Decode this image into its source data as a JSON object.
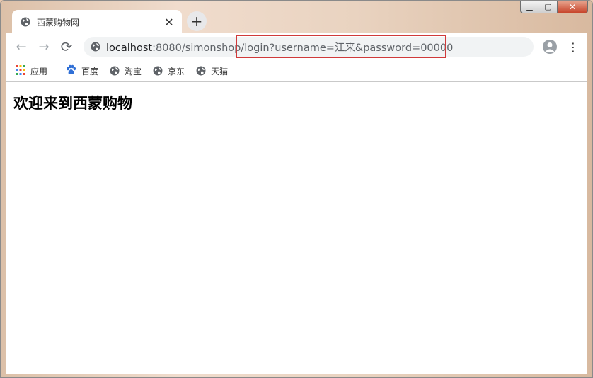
{
  "window": {
    "caption": {
      "minimize": "▁",
      "maximize": "▢",
      "close": "✕"
    }
  },
  "tab": {
    "title": "西蒙购物网",
    "close": "✕",
    "favicon": "globe-icon"
  },
  "new_tab": {
    "label": "+"
  },
  "toolbar": {
    "back": "←",
    "forward": "→",
    "reload": "⟳",
    "url_host": "localhost",
    "url_rest": ":8080/simonshop/login?username=江来&password=00000",
    "menu": "⋮"
  },
  "bookmarks": [
    {
      "label": "应用",
      "icon": "apps-grid-icon"
    },
    {
      "label": "百度",
      "icon": "baidu-paw-icon"
    },
    {
      "label": "淘宝",
      "icon": "globe-icon"
    },
    {
      "label": "京东",
      "icon": "globe-icon"
    },
    {
      "label": "天猫",
      "icon": "globe-icon"
    }
  ],
  "page": {
    "heading": "欢迎来到西蒙购物"
  },
  "colors": {
    "highlight_box": "#d03a3a",
    "omnibox_bg": "#f1f3f4"
  }
}
